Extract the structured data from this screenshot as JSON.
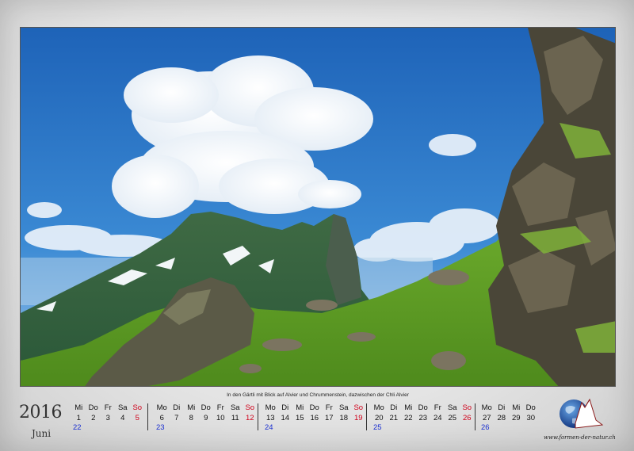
{
  "caption": "In den Gärtli mit Blick auf Alvier und Chrummenstein, dazwischen der Chli Alvier",
  "calendar": {
    "year": "2016",
    "month": "Juni",
    "weeks": [
      {
        "days": [
          {
            "name": "Mi",
            "num": "1"
          },
          {
            "name": "Do",
            "num": "2"
          },
          {
            "name": "Fr",
            "num": "3"
          },
          {
            "name": "Sa",
            "num": "4"
          },
          {
            "name": "So",
            "num": "5"
          }
        ],
        "kw": "22"
      },
      {
        "days": [
          {
            "name": "Mo",
            "num": "6"
          },
          {
            "name": "Di",
            "num": "7"
          },
          {
            "name": "Mi",
            "num": "8"
          },
          {
            "name": "Do",
            "num": "9"
          },
          {
            "name": "Fr",
            "num": "10"
          },
          {
            "name": "Sa",
            "num": "11"
          },
          {
            "name": "So",
            "num": "12"
          }
        ],
        "kw": "23"
      },
      {
        "days": [
          {
            "name": "Mo",
            "num": "13"
          },
          {
            "name": "Di",
            "num": "14"
          },
          {
            "name": "Mi",
            "num": "15"
          },
          {
            "name": "Do",
            "num": "16"
          },
          {
            "name": "Fr",
            "num": "17"
          },
          {
            "name": "Sa",
            "num": "18"
          },
          {
            "name": "So",
            "num": "19"
          }
        ],
        "kw": "24"
      },
      {
        "days": [
          {
            "name": "Mo",
            "num": "20"
          },
          {
            "name": "Di",
            "num": "21"
          },
          {
            "name": "Mi",
            "num": "22"
          },
          {
            "name": "Do",
            "num": "23"
          },
          {
            "name": "Fr",
            "num": "24"
          },
          {
            "name": "Sa",
            "num": "25"
          },
          {
            "name": "So",
            "num": "26"
          }
        ],
        "kw": "25"
      },
      {
        "days": [
          {
            "name": "Mo",
            "num": "27"
          },
          {
            "name": "Di",
            "num": "28"
          },
          {
            "name": "Mi",
            "num": "29"
          },
          {
            "name": "Do",
            "num": "30"
          }
        ],
        "kw": "26"
      }
    ]
  },
  "logo": {
    "icon": "globe-with-mountain-icon",
    "url": "www.formen-der-natur.ch"
  },
  "colors": {
    "sunday": "#d0021b",
    "week_number": "#1a2fd0",
    "sky": "#2b74c4"
  }
}
